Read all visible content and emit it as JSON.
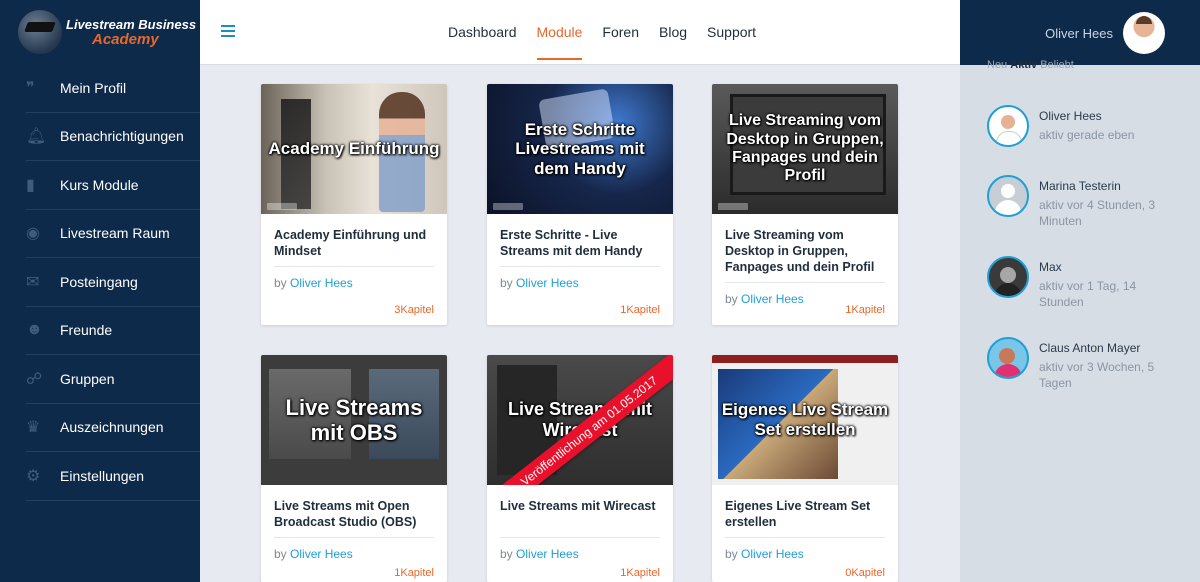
{
  "brand": {
    "line1": "Livestream Business",
    "line2": "Academy"
  },
  "sidebar": {
    "items": [
      {
        "label": "Mein Profil",
        "icon": "quote-icon"
      },
      {
        "label": "Benachrichtigungen",
        "icon": "bell-icon"
      },
      {
        "label": "Kurs Module",
        "icon": "document-icon"
      },
      {
        "label": "Livestream Raum",
        "icon": "circle-icon"
      },
      {
        "label": "Posteingang",
        "icon": "envelope-icon"
      },
      {
        "label": "Freunde",
        "icon": "users-icon"
      },
      {
        "label": "Gruppen",
        "icon": "groups-icon"
      },
      {
        "label": "Auszeichnungen",
        "icon": "trophy-icon"
      },
      {
        "label": "Einstellungen",
        "icon": "gears-icon"
      }
    ]
  },
  "topnav": {
    "items": [
      "Dashboard",
      "Module",
      "Foren",
      "Blog",
      "Support"
    ],
    "active": "Module"
  },
  "user": {
    "name": "Oliver Hees"
  },
  "members": {
    "tabs_peek": [
      "Neu",
      "Aktiv",
      "Beliebt"
    ],
    "list": [
      {
        "name": "Oliver Hees",
        "status": "aktiv gerade eben"
      },
      {
        "name": "Marina Testerin",
        "status": "aktiv vor 4 Stunden, 3 Minuten"
      },
      {
        "name": "Max",
        "status": "aktiv vor 1 Tag, 14 Stunden"
      },
      {
        "name": "Claus Anton Mayer",
        "status": "aktiv vor 3 Wochen, 5 Tagen"
      }
    ]
  },
  "by_label": "by",
  "courses": [
    {
      "thumb_text": "Academy Einführung",
      "title": "Academy Einführung und Mindset",
      "author": "Oliver Hees",
      "chapters": "3Kapitel"
    },
    {
      "thumb_text": "Erste Schritte Livestreams mit dem Handy",
      "title": "Erste Schritte - Live Streams mit dem Handy",
      "author": "Oliver Hees",
      "chapters": "1Kapitel"
    },
    {
      "thumb_text": "Live Streaming vom Desktop in Gruppen, Fanpages und dein Profil",
      "title": "Live Streaming vom Desktop in Gruppen, Fanpages und dein Profil",
      "author": "Oliver Hees",
      "chapters": "1Kapitel"
    },
    {
      "thumb_text": "Live Streams mit OBS",
      "title": "Live Streams mit Open Broadcast Studio (OBS)",
      "author": "Oliver Hees",
      "chapters": "1Kapitel"
    },
    {
      "thumb_text": "Live Streams mit Wirecast",
      "title": "Live Streams mit Wirecast",
      "author": "Oliver Hees",
      "chapters": "1Kapitel",
      "ribbon": "Veröffentlichung am 01.05.2017"
    },
    {
      "thumb_text": "Eigenes Live Stream Set erstellen",
      "title": "Eigenes Live Stream Set erstellen",
      "author": "Oliver Hees",
      "chapters": "0Kapitel"
    }
  ],
  "colors": {
    "sidebar": "#0e2a4a",
    "accent": "#e8672b",
    "link": "#1e9fd6",
    "background": "#e7ebf1"
  }
}
